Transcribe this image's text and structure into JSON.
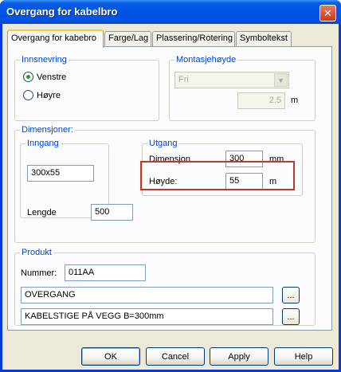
{
  "window": {
    "title": "Overgang for kabelbro",
    "close_glyph": "✕"
  },
  "tabs": [
    "Overgang for kabebro",
    "Farge/Lag",
    "Plassering/Rotering",
    "Symboltekst"
  ],
  "innsnevring": {
    "legend": "Innsnevring",
    "options": [
      {
        "label": "Venstre",
        "checked": true
      },
      {
        "label": "Høyre",
        "checked": false
      }
    ]
  },
  "montasjehoyde": {
    "legend": "Montasjehøyde",
    "select_value": "Fri",
    "value": "2.5",
    "unit": "m"
  },
  "dimensjoner": {
    "legend": "Dimensjoner:",
    "inngang": {
      "legend": "Inngang",
      "value": "300x55"
    },
    "utgang": {
      "legend": "Utgang",
      "dimensjon_label": "Dimensjon",
      "dimensjon_value": "300",
      "dimensjon_unit": "mm",
      "hoyde_label": "Høyde:",
      "hoyde_value": "55",
      "hoyde_unit": "m"
    },
    "lengde_label": "Lengde",
    "lengde_value": "500"
  },
  "produkt": {
    "legend": "Produkt",
    "nummer_label": "Nummer:",
    "nummer_value": "011AA",
    "line1": "OVERGANG",
    "line2": "KABELSTIGE PÅ VEGG B=300mm",
    "browse_label": "..."
  },
  "buttons": {
    "ok": "OK",
    "cancel": "Cancel",
    "apply": "Apply",
    "help": "Help"
  },
  "colors": {
    "title_bar": "#0054e3",
    "group_legend": "#0046d5",
    "highlight_box": "#c0392b"
  }
}
